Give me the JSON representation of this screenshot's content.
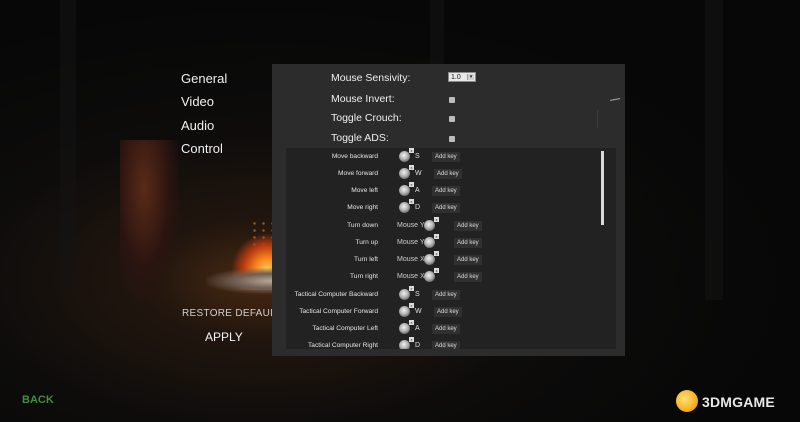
{
  "menu": {
    "items": [
      "General",
      "Video",
      "Audio",
      "Control"
    ],
    "restore_label": "RESTORE DEFAULT",
    "apply_label": "APPLY",
    "back_label": "BACK"
  },
  "settings": {
    "sensitivity_label": "Mouse Sensivity:",
    "sensitivity_value": "1.0",
    "invert_label": "Mouse Invert:",
    "crouch_label": "Toggle Crouch:",
    "ads_label": "Toggle ADS:"
  },
  "bindings": {
    "add_key": "Add key",
    "rows": [
      {
        "action": "Move backward",
        "key": "S"
      },
      {
        "action": "Move forward",
        "key": "W"
      },
      {
        "action": "Move left",
        "key": "A"
      },
      {
        "action": "Move right",
        "key": "D"
      },
      {
        "action": "Turn down",
        "mouse": "Mouse Y"
      },
      {
        "action": "Turn up",
        "mouse": "Mouse Y"
      },
      {
        "action": "Turn left",
        "mouse": "Mouse X"
      },
      {
        "action": "Turn right",
        "mouse": "Mouse X"
      },
      {
        "action": "Tactical Computer Backward",
        "key": "S"
      },
      {
        "action": "Tactical Computer Forward",
        "key": "W"
      },
      {
        "action": "Tactical Computer Left",
        "key": "A"
      },
      {
        "action": "Tactical Computer Right",
        "key": "D"
      }
    ]
  },
  "watermark": {
    "text": "3DMGAME"
  },
  "colors": {
    "back": "#3f8f3f",
    "panel": "#2c2c2c",
    "list": "#222222"
  }
}
